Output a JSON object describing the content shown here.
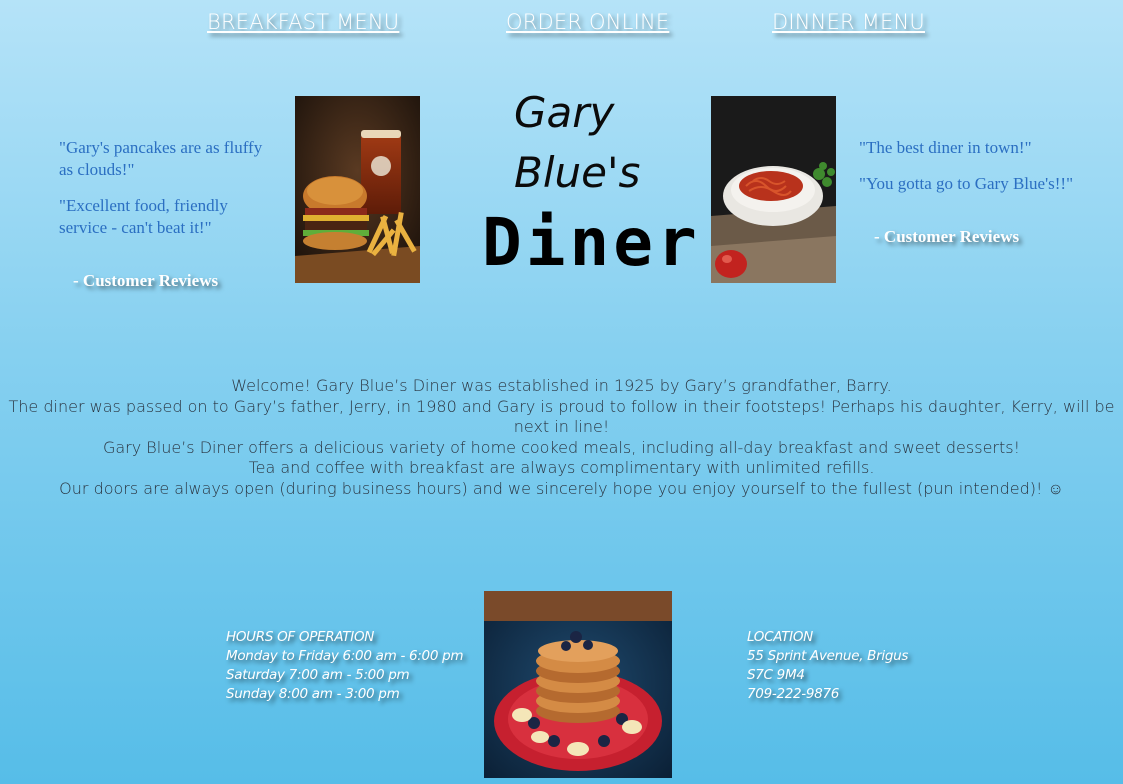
{
  "nav": {
    "breakfast": "BREAKFAST MENU",
    "order": "ORDER ONLINE",
    "dinner": "DINNER MENU"
  },
  "reviews_left": {
    "quote1": "\"Gary's pancakes are as fluffy as clouds!\"",
    "quote2": "\"Excellent food, friendly service - can't beat it!\"",
    "attribution": "- Customer Reviews"
  },
  "reviews_right": {
    "quote1": "\"The best diner in town!\"",
    "quote2": "\"You gotta go to Gary Blue's!!\"",
    "attribution": "- Customer Reviews"
  },
  "logo": {
    "line1": "Gary",
    "line2": "Blue's",
    "line3": "Diner"
  },
  "welcome": {
    "lines": [
      "Welcome! Gary Blue’s Diner was established in 1925 by Gary’s grandfather, Barry.",
      "The diner was passed on to Gary’s father, Jerry, in 1980 and Gary is proud to follow in their footsteps! Perhaps his daughter, Kerry, will be next in line!",
      "Gary Blue’s Diner offers a delicious variety of home cooked meals, including all-day breakfast and sweet desserts!",
      "Tea and coffee with breakfast are always complimentary with unlimited refills.",
      "Our doors are always open (during business hours) and we sincerely hope you enjoy yourself to the fullest (pun intended)! ☺"
    ]
  },
  "hours": {
    "heading": "HOURS OF OPERATION",
    "line1": "Monday to Friday 6:00 am - 6:00 pm",
    "line2": "Saturday 7:00 am - 5:00 pm",
    "line3": "Sunday 8:00 am - 3:00 pm"
  },
  "location": {
    "heading": "LOCATION",
    "address": "55 Sprint Avenue, Brigus",
    "postal": "S7C 9M4",
    "phone": "709-222-9876"
  },
  "images": {
    "left": "burger-and-beer-photo",
    "right": "pasta-bowl-photo",
    "bottom": "pancake-stack-photo"
  }
}
